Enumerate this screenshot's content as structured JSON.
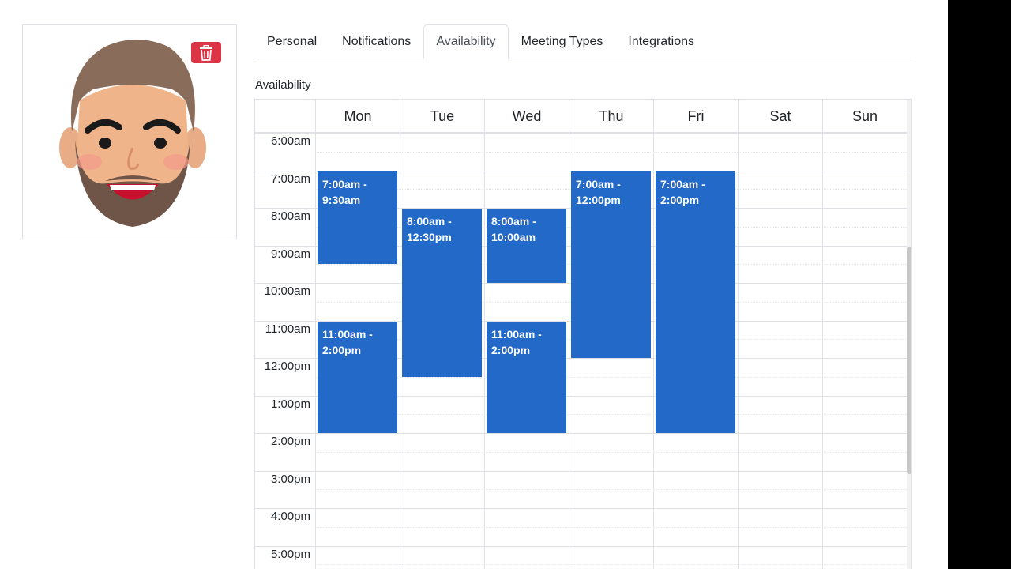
{
  "tabs": [
    {
      "label": "Personal"
    },
    {
      "label": "Notifications"
    },
    {
      "label": "Availability"
    },
    {
      "label": "Meeting Types"
    },
    {
      "label": "Integrations"
    }
  ],
  "active_tab": "Availability",
  "section_label": "Availability",
  "calendar": {
    "days": [
      "Mon",
      "Tue",
      "Wed",
      "Thu",
      "Fri",
      "Sat",
      "Sun"
    ],
    "times": [
      "6:00am",
      "7:00am",
      "8:00am",
      "9:00am",
      "10:00am",
      "11:00am",
      "12:00pm",
      "1:00pm",
      "2:00pm",
      "3:00pm",
      "4:00pm",
      "5:00pm"
    ],
    "events": [
      {
        "day": "Mon",
        "start": 7,
        "end": 9.5,
        "line1": "7:00am -",
        "line2": "9:30am"
      },
      {
        "day": "Mon",
        "start": 11,
        "end": 14,
        "line1": "11:00am -",
        "line2": "2:00pm"
      },
      {
        "day": "Tue",
        "start": 8,
        "end": 12.5,
        "line1": "8:00am -",
        "line2": "12:30pm"
      },
      {
        "day": "Wed",
        "start": 8,
        "end": 10,
        "line1": "8:00am -",
        "line2": "10:00am"
      },
      {
        "day": "Wed",
        "start": 11,
        "end": 14,
        "line1": "11:00am -",
        "line2": "2:00pm"
      },
      {
        "day": "Thu",
        "start": 7,
        "end": 12,
        "line1": "7:00am -",
        "line2": "12:00pm"
      },
      {
        "day": "Fri",
        "start": 7,
        "end": 14,
        "line1": "7:00am -",
        "line2": "2:00pm"
      }
    ],
    "event_color": "#2369c8"
  },
  "avatar": {
    "icon": "cartoon-face-avatar"
  },
  "delete_button": {
    "icon": "trash-icon",
    "color": "#dc3545"
  }
}
